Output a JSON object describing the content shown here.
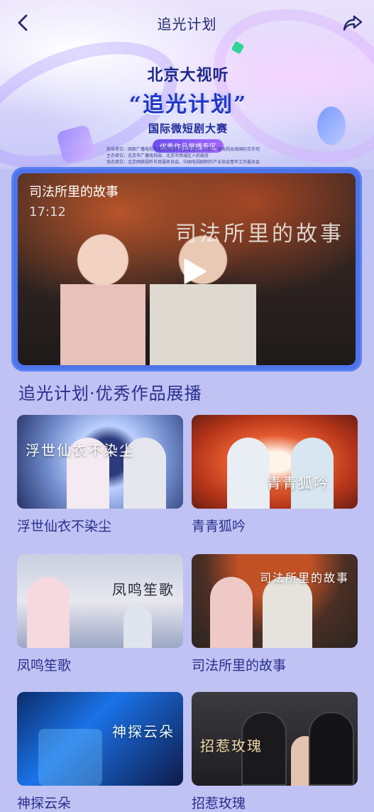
{
  "header": {
    "title": "追光计划"
  },
  "banner": {
    "line1": "北京大视听",
    "line2": "“追光计划”",
    "line3": "国际微短剧大赛",
    "line4": "优秀作品展播专区",
    "credits": [
      "指导单位：国家广播电视总局网络视听节目管理司、国家广播电视总局国际合作司",
      "主办单位：北京市广播电视局、北京市西城区人民政府",
      "协办单位：北京网络视听节目服务协会、中国电视剧制作产业协会青年工作委员会"
    ]
  },
  "player": {
    "title": "司法所里的故事",
    "duration": "17:12",
    "calligraphy": "司法所里的故事"
  },
  "section": {
    "title": "追光计划·优秀作品展播"
  },
  "cards": [
    {
      "label": "浮世仙衣不染尘",
      "overlay": "浮世仙衣不染尘"
    },
    {
      "label": "青青狐吟",
      "overlay": "青青狐吟"
    },
    {
      "label": "凤鸣笙歌",
      "overlay": "凤鸣笙歌"
    },
    {
      "label": "司法所里的故事",
      "overlay": "司法所里的故事"
    },
    {
      "label": "神探云朵",
      "overlay": "神探云朵"
    },
    {
      "label": "招惹玫瑰",
      "overlay": "招惹玫瑰"
    }
  ],
  "icons": {
    "back": "chevron-left-icon",
    "share": "share-icon",
    "play": "play-icon"
  },
  "colors": {
    "background": "#bfc2f2",
    "accent": "#4e73e8",
    "text": "#2a2f8f"
  }
}
